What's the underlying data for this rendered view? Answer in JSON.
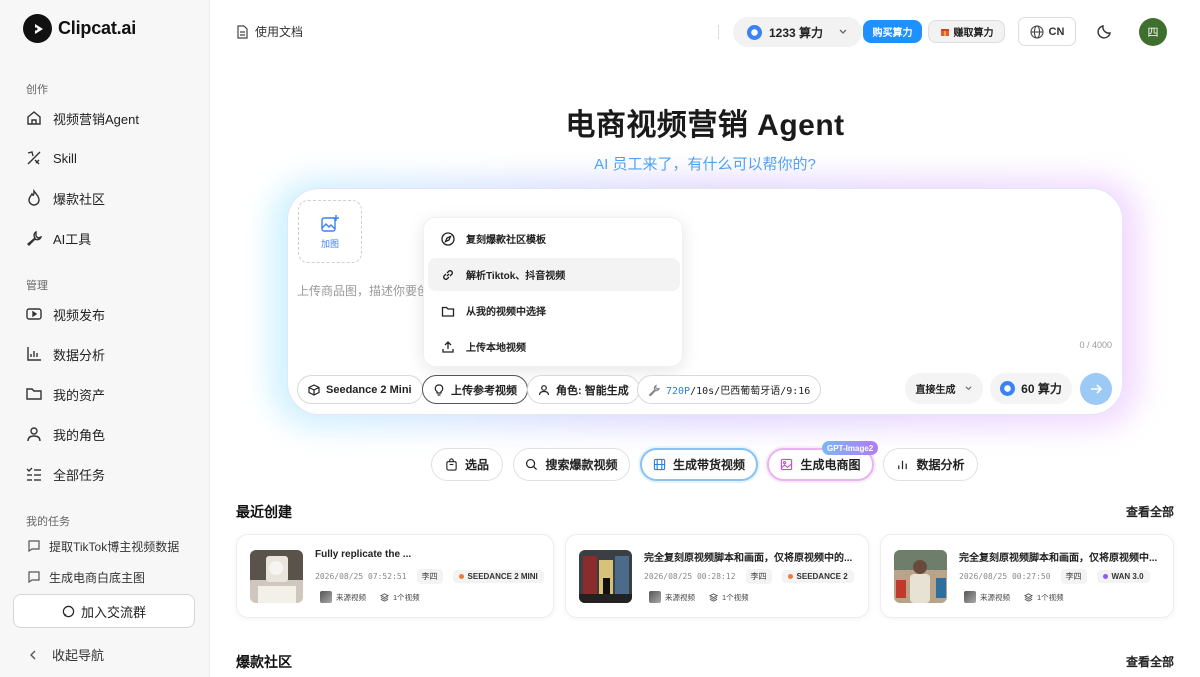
{
  "brand": {
    "name": "Clipcat.ai"
  },
  "sidebar": {
    "sections": [
      {
        "label": "创作",
        "items": [
          {
            "label": "视频营销Agent",
            "icon": "home-icon"
          },
          {
            "label": "Skill",
            "icon": "skill-icon"
          },
          {
            "label": "爆款社区",
            "icon": "flame-icon"
          },
          {
            "label": "AI工具",
            "icon": "wrench-icon"
          }
        ]
      },
      {
        "label": "管理",
        "items": [
          {
            "label": "视频发布",
            "icon": "video-icon"
          },
          {
            "label": "数据分析",
            "icon": "chart-icon"
          },
          {
            "label": "我的资产",
            "icon": "folder-icon"
          },
          {
            "label": "我的角色",
            "icon": "user-icon"
          },
          {
            "label": "全部任务",
            "icon": "tasklist-icon"
          }
        ]
      }
    ],
    "tasks_label": "我的任务",
    "tasks": [
      {
        "label": "提取TikTok博主视频数据"
      },
      {
        "label": "生成电商白底主图"
      }
    ],
    "join_group": "加入交流群",
    "collapse": "收起导航"
  },
  "header": {
    "docs": "使用文档",
    "credits": "1233 算力",
    "buy": "购买算力",
    "earn": "赚取算力",
    "lang": "CN",
    "avatar_text": "四"
  },
  "hero": {
    "title": "电商视频营销 Agent",
    "subtitle": "AI 员工来了，有什么可以帮你的?"
  },
  "composer": {
    "add_image": "加图",
    "placeholder": "上传商品图，描述你要创",
    "counter": "0 / 4000",
    "dropdown": [
      {
        "label": "复刻爆款社区模板",
        "icon": "compass-icon"
      },
      {
        "label": "解析Tiktok、抖音视频",
        "icon": "link-icon"
      },
      {
        "label": "从我的视频中选择",
        "icon": "folder-icon"
      },
      {
        "label": "上传本地视频",
        "icon": "upload-icon"
      }
    ],
    "model": "Seedance 2 Mini",
    "upload_ref": "上传参考视频",
    "role": "角色: 智能生成",
    "settings_hl": "720P",
    "settings_rest": "/10s/巴西葡萄牙语/9:16",
    "mode": "直接生成",
    "cost": "60 算力"
  },
  "quick_actions": [
    {
      "label": "选品",
      "icon": "bag-icon"
    },
    {
      "label": "搜索爆款视频",
      "icon": "search-icon"
    },
    {
      "label": "生成带货视频",
      "icon": "film-icon"
    },
    {
      "label": "生成电商图",
      "icon": "image-icon",
      "badge": "GPT-Image2"
    },
    {
      "label": "数据分析",
      "icon": "bar-chart-icon"
    }
  ],
  "recent": {
    "title": "最近创建",
    "view_all": "查看全部",
    "cards": [
      {
        "title": "Fully replicate the ...",
        "time": "2026/08/25 07:52:51",
        "user": "李四",
        "model": "SEEDANCE 2 MINI",
        "model_color": "#f07b3a",
        "source": "来源视频",
        "count": "1个视频"
      },
      {
        "title": "完全复刻原视频脚本和画面，仅将原视频中的...",
        "time": "2026/08/25 00:28:12",
        "user": "李四",
        "model": "SEEDANCE 2",
        "model_color": "#f07b3a",
        "source": "来源视频",
        "count": "1个视频"
      },
      {
        "title": "完全复刻原视频脚本和画面，仅将原视频中...",
        "time": "2026/08/25 00:27:50",
        "user": "李四",
        "model": "WAN 3.0",
        "model_color": "#8b5cf6",
        "source": "来源视频",
        "count": "1个视频"
      }
    ]
  },
  "community": {
    "title": "爆款社区",
    "view_all": "查看全部"
  }
}
